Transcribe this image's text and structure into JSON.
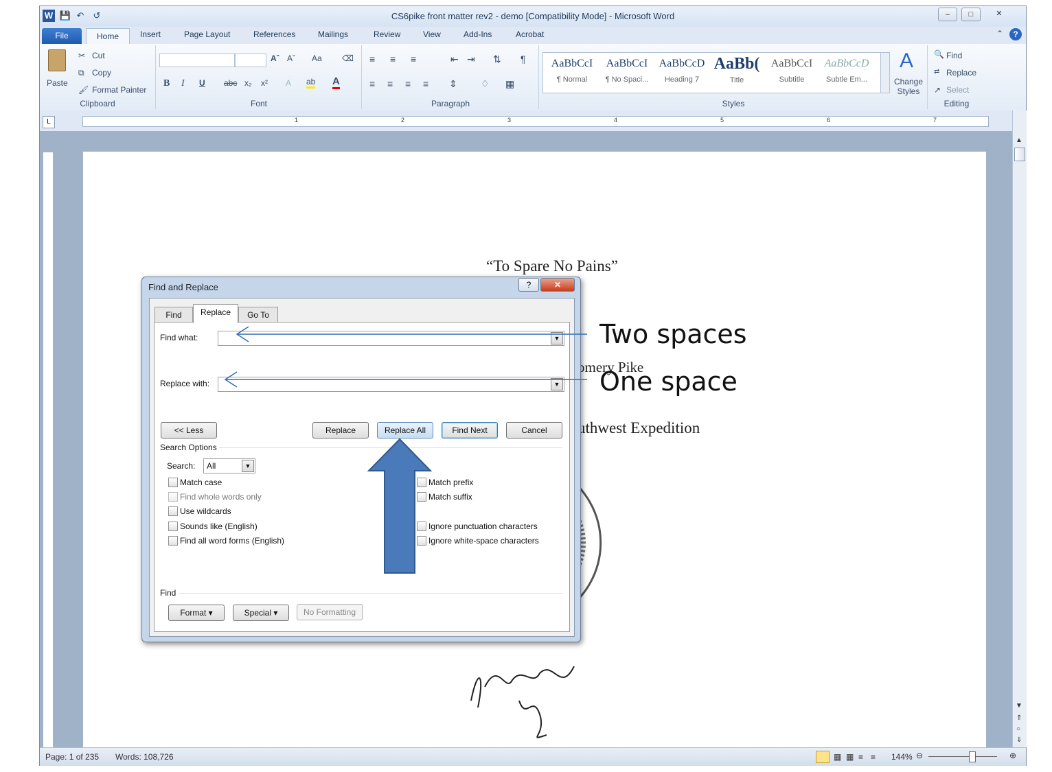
{
  "window": {
    "title": "CS6pike front matter rev2 - demo [Compatibility Mode] - Microsoft Word",
    "minimize": "–",
    "maximize": "□",
    "close": "✕"
  },
  "tabs": [
    "File",
    "Home",
    "Insert",
    "Page Layout",
    "References",
    "Mailings",
    "Review",
    "View",
    "Add-Ins",
    "Acrobat"
  ],
  "ribbon": {
    "clipboard": {
      "label": "Clipboard",
      "paste": "Paste",
      "cut": "Cut",
      "copy": "Copy",
      "format_painter": "Format Painter"
    },
    "font": {
      "label": "Font",
      "bold": "B",
      "italic": "I",
      "underline": "U",
      "strike": "abc",
      "sub": "x₂",
      "sup": "x²",
      "aa": "Aa"
    },
    "paragraph": {
      "label": "Paragraph"
    },
    "styles": {
      "label": "Styles",
      "items": [
        {
          "preview": "AaBbCcI",
          "name": "¶ Normal"
        },
        {
          "preview": "AaBbCcI",
          "name": "¶ No Spaci..."
        },
        {
          "preview": "AaBbCcD",
          "name": "Heading 7"
        },
        {
          "preview": "AaBb(",
          "name": "Title"
        },
        {
          "preview": "AaBbCcI",
          "name": "Subtitle"
        },
        {
          "preview": "AaBbCcD",
          "name": "Subtle Em..."
        }
      ],
      "change_styles": "Change Styles"
    },
    "editing": {
      "label": "Editing",
      "find": "Find",
      "replace": "Replace",
      "select": "Select"
    }
  },
  "ruler": {
    "numbers": [
      "1",
      "2",
      "3",
      "4",
      "5",
      "6",
      "7"
    ]
  },
  "document": {
    "line1": "“To Spare No Pains”",
    "line2": "omery Pike",
    "line3": "uthwest Expedition"
  },
  "status": {
    "page": "Page: 1 of 235",
    "words": "Words: 108,726",
    "zoom": "144%"
  },
  "dialog": {
    "title": "Find and Replace",
    "help": "?",
    "close": "✕",
    "tabs": [
      "Find",
      "Replace",
      "Go To"
    ],
    "find_what_label": "Find what:",
    "replace_with_label": "Replace with:",
    "buttons": {
      "less": "<< Less",
      "replace": "Replace",
      "replace_all": "Replace All",
      "find_next": "Find Next",
      "cancel": "Cancel"
    },
    "search_options_label": "Search Options",
    "search_label": "Search:",
    "search_value": "All",
    "options_left": [
      "Match case",
      "Find whole words only",
      "Use wildcards",
      "Sounds like (English)",
      "Find all word forms (English)"
    ],
    "options_right": [
      "Match prefix",
      "Match suffix",
      "Ignore punctuation characters",
      "Ignore white-space characters"
    ],
    "find_section_label": "Find",
    "format_button": "Format ▾",
    "special_button": "Special ▾",
    "no_formatting_button": "No Formatting"
  },
  "annotations": {
    "two_spaces": "Two spaces",
    "one_space": "One space"
  },
  "colors": {
    "arrow_fill": "#4a7ab9",
    "arrow_stroke": "#2f5a8f",
    "file_tab": "#2a67c2"
  }
}
